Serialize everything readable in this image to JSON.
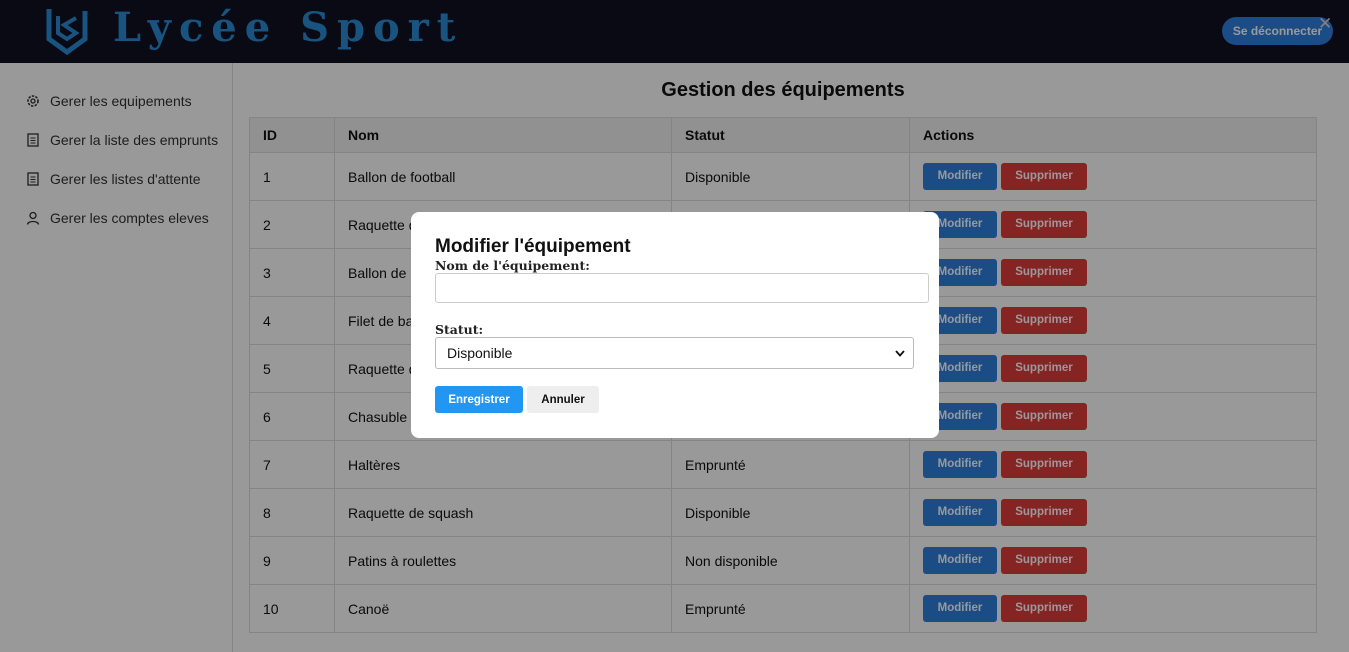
{
  "header": {
    "brand": "Lycée Sport",
    "logout_label": "Se déconnecter",
    "close_glyph": "✕"
  },
  "sidebar": {
    "items": [
      {
        "label": "Gerer les equipements",
        "icon": "gear-icon"
      },
      {
        "label": "Gerer la liste des emprunts",
        "icon": "document-icon"
      },
      {
        "label": "Gerer les listes d'attente",
        "icon": "document-icon"
      },
      {
        "label": "Gerer les comptes eleves",
        "icon": "user-icon"
      }
    ]
  },
  "main": {
    "title": "Gestion des équipements",
    "table": {
      "headers": [
        "ID",
        "Nom",
        "Statut",
        "Actions"
      ],
      "modify_label": "Modifier",
      "delete_label": "Supprimer",
      "rows": [
        {
          "id": "1",
          "name": "Ballon de football",
          "status": "Disponible"
        },
        {
          "id": "2",
          "name": "Raquette d",
          "status": ""
        },
        {
          "id": "3",
          "name": "Ballon de b",
          "status": ""
        },
        {
          "id": "4",
          "name": "Filet de bad",
          "status": ""
        },
        {
          "id": "5",
          "name": "Raquette d",
          "status": ""
        },
        {
          "id": "6",
          "name": "Chasuble d",
          "status": ""
        },
        {
          "id": "7",
          "name": "Haltères",
          "status": "Emprunté"
        },
        {
          "id": "8",
          "name": "Raquette de squash",
          "status": "Disponible"
        },
        {
          "id": "9",
          "name": "Patins à roulettes",
          "status": "Non disponible"
        },
        {
          "id": "10",
          "name": "Canoë",
          "status": "Emprunté"
        }
      ]
    }
  },
  "modal": {
    "title": "Modifier l'équipement",
    "name_label": "Nom de l'équipement:",
    "name_value": "",
    "status_label": "Statut:",
    "status_value": "Disponible",
    "save_label": "Enregistrer",
    "cancel_label": "Annuler"
  },
  "colors": {
    "header_bg": "#0f1120",
    "brand": "#2a8cd6",
    "primary": "#2d7fdf",
    "danger": "#e03b3b"
  }
}
